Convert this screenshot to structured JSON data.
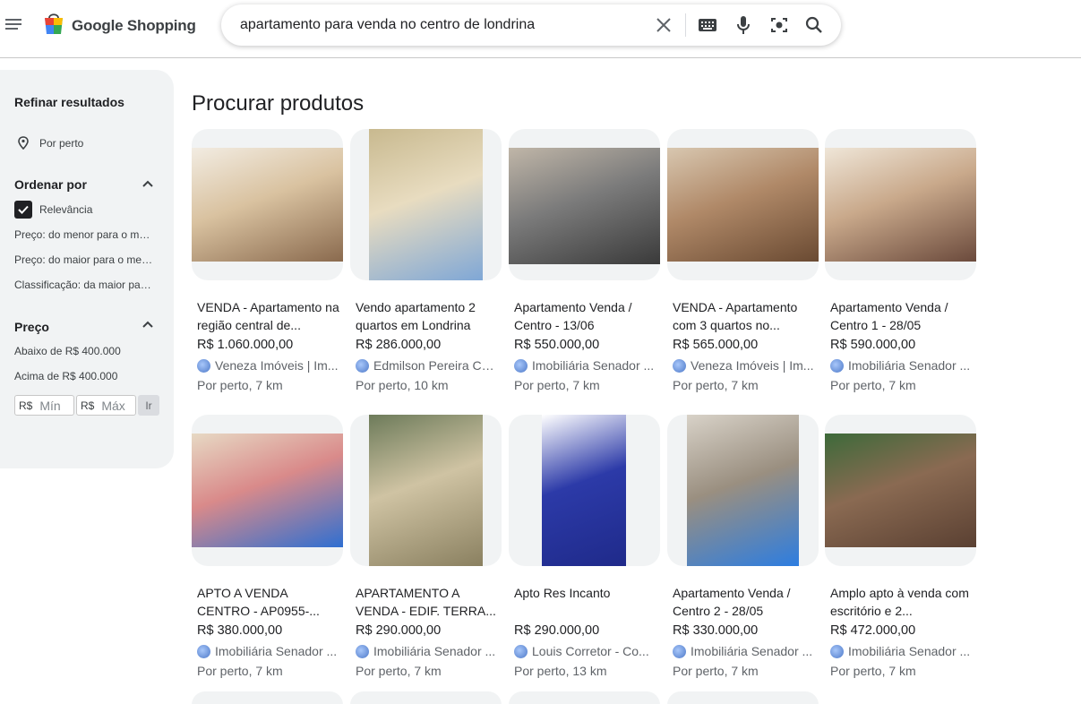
{
  "header": {
    "logo_text": "Google Shopping",
    "search_query": "apartamento para venda no centro de londrina"
  },
  "sidebar": {
    "refine_title": "Refinar resultados",
    "nearby": "Por perto",
    "sort_title": "Ordenar por",
    "sort_options": [
      "Relevância",
      "Preço: do menor para o maior",
      "Preço: do maior para o menor",
      "Classificação: da maior para a menor"
    ],
    "price_title": "Preço",
    "price_options": [
      "Abaixo de R$ 400.000",
      "Acima de R$ 400.000"
    ],
    "currency": "R$",
    "min_placeholder": "Mín",
    "max_placeholder": "Máx",
    "go_label": "Ir"
  },
  "main": {
    "title": "Procurar produtos",
    "products": [
      {
        "title": "VENDA - Apartamento na região central de...",
        "price": "R$ 1.060.000,00",
        "seller": "Veneza Imóveis | Im...",
        "distance": "Por perto, 7 km",
        "colors": [
          "#8a6a4e",
          "#d9c2a0",
          "#f2ece2"
        ]
      },
      {
        "title": "Vendo apartamento 2 quartos em Londrina",
        "price": "R$ 286.000,00",
        "seller": "Edmilson Pereira Co...",
        "distance": "Por perto, 10 km",
        "colors": [
          "#7fa7d6",
          "#e8dcc0",
          "#c8b98f"
        ]
      },
      {
        "title": "Apartamento Venda / Centro - 13/06",
        "price": "R$ 550.000,00",
        "seller": "Imobiliária Senador ...",
        "distance": "Por perto, 7 km",
        "colors": [
          "#3a3a3a",
          "#7b7b7b",
          "#c0b6a8"
        ]
      },
      {
        "title": "VENDA - Apartamento com 3 quartos no...",
        "price": "R$ 565.000,00",
        "seller": "Veneza Imóveis | Im...",
        "distance": "Por perto, 7 km",
        "colors": [
          "#6a4a32",
          "#b08968",
          "#d8c7b0"
        ]
      },
      {
        "title": "Apartamento Venda / Centro 1 - 28/05",
        "price": "R$ 590.000,00",
        "seller": "Imobiliária Senador ...",
        "distance": "Por perto, 7 km",
        "colors": [
          "#6b4a3c",
          "#c9a98b",
          "#efe6d8"
        ]
      },
      {
        "title": "APTO A VENDA CENTRO - AP0955-...",
        "price": "R$ 380.000,00",
        "seller": "Imobiliária Senador ...",
        "distance": "Por perto, 7 km",
        "colors": [
          "#2f6fd1",
          "#d98a8a",
          "#e7d9c4"
        ]
      },
      {
        "title": "APARTAMENTO A VENDA - EDIF. TERRA...",
        "price": "R$ 290.000,00",
        "seller": "Imobiliária Senador ...",
        "distance": "Por perto, 7 km",
        "colors": [
          "#8a8060",
          "#cfc3a3",
          "#6d7b5a"
        ]
      },
      {
        "title": "Apto Res Incanto",
        "price": "R$ 290.000,00",
        "seller": "Louis Corretor - Co...",
        "distance": "Por perto, 13 km",
        "colors": [
          "#1f2a8a",
          "#2c3aa8",
          "#ffffff"
        ]
      },
      {
        "title": "Apartamento Venda / Centro 2 - 28/05",
        "price": "R$ 330.000,00",
        "seller": "Imobiliária Senador ...",
        "distance": "Por perto, 7 km",
        "colors": [
          "#2d7de0",
          "#9a8f80",
          "#d8d2c8"
        ]
      },
      {
        "title": "Amplo apto à venda com escritório e 2...",
        "price": "R$ 472.000,00",
        "seller": "Imobiliária Senador ...",
        "distance": "Por perto, 7 km",
        "colors": [
          "#5a4032",
          "#8a6a52",
          "#3d6a3a"
        ]
      }
    ]
  }
}
